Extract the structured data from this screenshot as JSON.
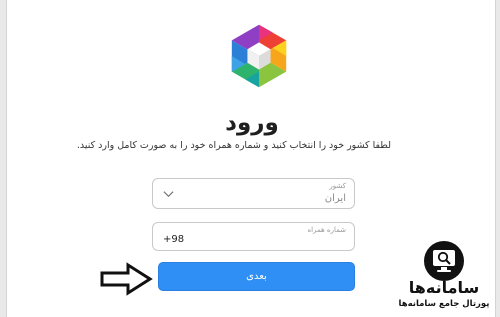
{
  "login": {
    "title": "ورود",
    "subtitle": "لطفا کشور خود را انتخاب کنید و شماره همراه خود را به صورت کامل وارد کنید.",
    "country_label": "کشور",
    "country_value": "ایران",
    "phone_label": "شماره همراه",
    "phone_value": "+98",
    "next_label": "بعدی"
  },
  "watermark": {
    "name": "سامانه‌ها",
    "tagline": "پورتال جامع سامانه‌ها"
  },
  "colors": {
    "button": "#2f8ff5",
    "background": "#ffffff"
  },
  "icons": {
    "logo": "rubika-hexagon-logo",
    "country_dropdown": "chevron-down-icon",
    "pointer": "arrow-right-icon",
    "brand": "monitor-search-icon"
  }
}
